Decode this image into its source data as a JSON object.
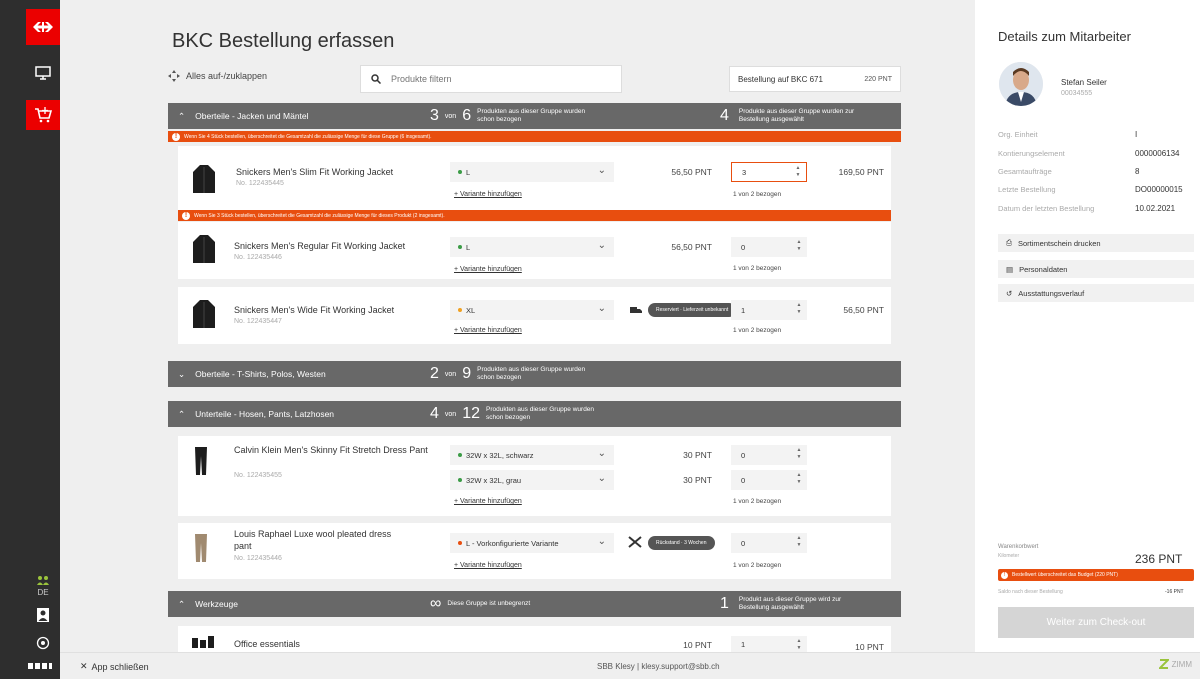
{
  "app": {
    "page_title": "BKC Bestellung erfassen",
    "toggle_all": "Alles auf-/zuklappen",
    "search_placeholder": "Produkte filtern",
    "budget_label": "Bestellung auf BKC 671",
    "budget_amount": "220 PNT",
    "language": "DE"
  },
  "groups": [
    {
      "title": "Oberteile - Jacken und Mäntel",
      "count": "3",
      "von": "von",
      "total": "6",
      "desc": "Produkten aus dieser Gruppe wurden schon bezogen",
      "sel_count": "4",
      "sel_desc": "Produkte aus dieser Gruppe wurden zur Bestellung ausgewählt",
      "warning": "Wenn Sie 4 Stück bestellen, überschreitet die Gesamtzahl die zulässige Menge für diese Gruppe (6 insgesamt)."
    },
    {
      "title": "Oberteile - T-Shirts, Polos, Westen",
      "count": "2",
      "von": "von",
      "total": "9",
      "desc": "Produkten aus dieser Gruppe wurden schon bezogen"
    },
    {
      "title": "Unterteile - Hosen, Pants, Latzhosen",
      "count": "4",
      "von": "von",
      "total": "12",
      "desc": "Produkten aus dieser Gruppe wurden schon bezogen"
    },
    {
      "title": "Werkzeuge",
      "count": "∞",
      "desc": "Diese Gruppe ist unbegrenzt",
      "sel_count": "1",
      "sel_desc": "Produkt aus dieser Gruppe wird zur Bestellung ausgewählt"
    }
  ],
  "products": [
    {
      "name": "Snickers Men's Slim Fit Working Jacket",
      "no": "No. 122435445",
      "variant": "L",
      "add_variant": "+ Variante hinzufügen",
      "price": "56,50 PNT",
      "qty": "3",
      "used": "1 von 2 bezogen",
      "total": "169,50 PNT",
      "warning": "Wenn Sie 3 Stück bestellen, überschreitet die Gesamtzahl die zulässige Menge für dieses Produkt (2 insgesamt)."
    },
    {
      "name": "Snickers Men's Regular Fit Working Jacket",
      "no": "No. 122435446",
      "variant": "L",
      "add_variant": "+ Variante hinzufügen",
      "price": "56,50 PNT",
      "qty": "0",
      "used": "1 von 2 bezogen"
    },
    {
      "name": "Snickers Men's Wide Fit Working Jacket",
      "no": "No. 122435447",
      "variant": "XL",
      "add_variant": "+ Variante hinzufügen",
      "tip": "Reserviert · Lieferzeit unbekannt",
      "qty": "1",
      "used": "1 von 2 bezogen",
      "total": "56,50 PNT"
    },
    {
      "name": "Calvin Klein Men's Skinny Fit Stretch Dress Pant",
      "no": "No. 122435455",
      "variants": [
        {
          "label": "32W x 32L, schwarz",
          "price": "30 PNT",
          "qty": "0"
        },
        {
          "label": "32W x 32L, grau",
          "price": "30 PNT",
          "qty": "0"
        }
      ],
      "add_variant": "+ Variante hinzufügen",
      "used": "1 von 2 bezogen"
    },
    {
      "name": "Louis Raphael Luxe wool pleated dress pant",
      "no": "No. 122435446",
      "variant": "L - Vorkonfigurierte Variante",
      "add_variant": "+ Variante hinzufügen",
      "tip": "Rückstand · 3 Wochen",
      "qty": "0",
      "used": "1 von 2 bezogen"
    },
    {
      "name": "Office essentials",
      "price": "10 PNT",
      "qty": "1",
      "total": "10 PNT"
    }
  ],
  "panel": {
    "title": "Details zum Mitarbeiter",
    "emp_name": "Stefan Seiler",
    "emp_no": "00034555",
    "fields": [
      {
        "k": "Org. Einheit",
        "v": "I"
      },
      {
        "k": "Kontierungselement",
        "v": "0000006134"
      },
      {
        "k": "Gesamtaufträge",
        "v": "8"
      },
      {
        "k": "Letzte Bestellung",
        "v": "DO00000015"
      },
      {
        "k": "Datum der letzten Bestellung",
        "v": "10.02.2021"
      }
    ],
    "buttons": [
      "Sortimentschein drucken",
      "Personaldaten",
      "Ausstattungsverlauf"
    ],
    "cart_label": "Warenkorbwert",
    "cart_sub": "Kilometer",
    "cart_value": "236 PNT",
    "budget_warning": "Bestellwert überschreitet das Budget (220 PNT)",
    "saldo_label": "Saldo nach dieser Bestellung",
    "saldo_value": "-16 PNT",
    "checkout": "Weiter zum Check-out"
  },
  "footer": {
    "close": "App schließen",
    "support": "SBB Klesy | klesy.support@sbb.ch",
    "brand": "ZIMM"
  },
  "colors": {
    "accent": "#eb0000",
    "warning": "#e84e0f",
    "group_bar": "#686868",
    "rail": "#2e2e2e"
  }
}
